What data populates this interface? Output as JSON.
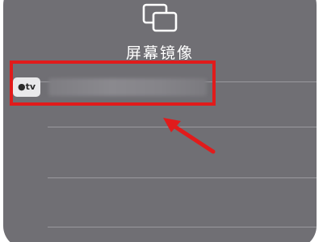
{
  "screen_mirroring": {
    "icon": "screen-mirroring-icon",
    "title": "屏幕镜像",
    "devices": [
      {
        "icon": "apple-tv-icon",
        "badge": "tv",
        "name": ""
      }
    ]
  },
  "annotation": {
    "highlight_color": "#e11b1b",
    "arrow": "pointer-arrow"
  },
  "colors": {
    "panel_background": "#706f74",
    "divider": "#9a999e",
    "text": "#ffffff"
  }
}
